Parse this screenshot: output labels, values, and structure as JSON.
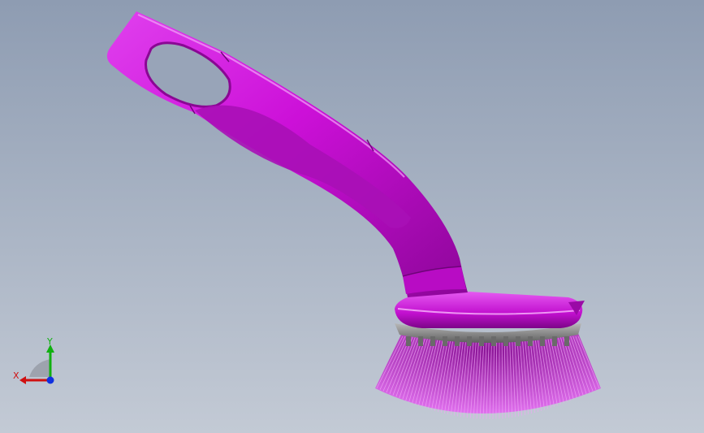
{
  "viewport": {
    "background_top": "#8e9cb2",
    "background_bottom": "#c3cad5"
  },
  "model": {
    "part_color": "#cc10d8",
    "part_shadow_color": "#7a0585",
    "bristle_color": "#c23ad0",
    "base_plate_color": "#8a8a8a"
  },
  "triad": {
    "x_label": "X",
    "y_label": "Y",
    "x_color": "#d01010",
    "y_color": "#10b010",
    "z_color": "#1030e0"
  }
}
